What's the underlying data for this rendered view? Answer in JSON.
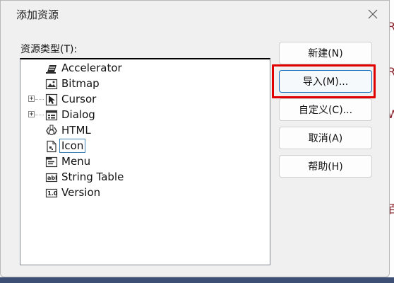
{
  "dialog": {
    "title": "添加资源",
    "tree_label": "资源类型(T):",
    "items": [
      {
        "label": "Accelerator",
        "icon": "accelerator-icon",
        "expandable": false
      },
      {
        "label": "Bitmap",
        "icon": "bitmap-icon",
        "expandable": false
      },
      {
        "label": "Cursor",
        "icon": "cursor-icon",
        "expandable": true,
        "expander": "+"
      },
      {
        "label": "Dialog",
        "icon": "dialog-icon",
        "expandable": true,
        "expander": "+"
      },
      {
        "label": "HTML",
        "icon": "html-icon",
        "expandable": false
      },
      {
        "label": "Icon",
        "icon": "icon-resource-icon",
        "expandable": false,
        "selected": true
      },
      {
        "label": "Menu",
        "icon": "menu-icon",
        "expandable": false
      },
      {
        "label": "String Table",
        "icon": "string-table-icon",
        "expandable": false,
        "icon_text": "abl"
      },
      {
        "label": "Version",
        "icon": "version-icon",
        "expandable": false,
        "icon_text": "1.0"
      }
    ],
    "buttons": {
      "new": "新建(N)",
      "import": "导入(M)...",
      "custom": "自定义(C)...",
      "cancel": "取消(A)",
      "help": "帮助(H)"
    }
  },
  "colors": {
    "highlight": "#e00000",
    "primary_border": "#0f6cbd",
    "selection_border": "#3c7fb1"
  }
}
